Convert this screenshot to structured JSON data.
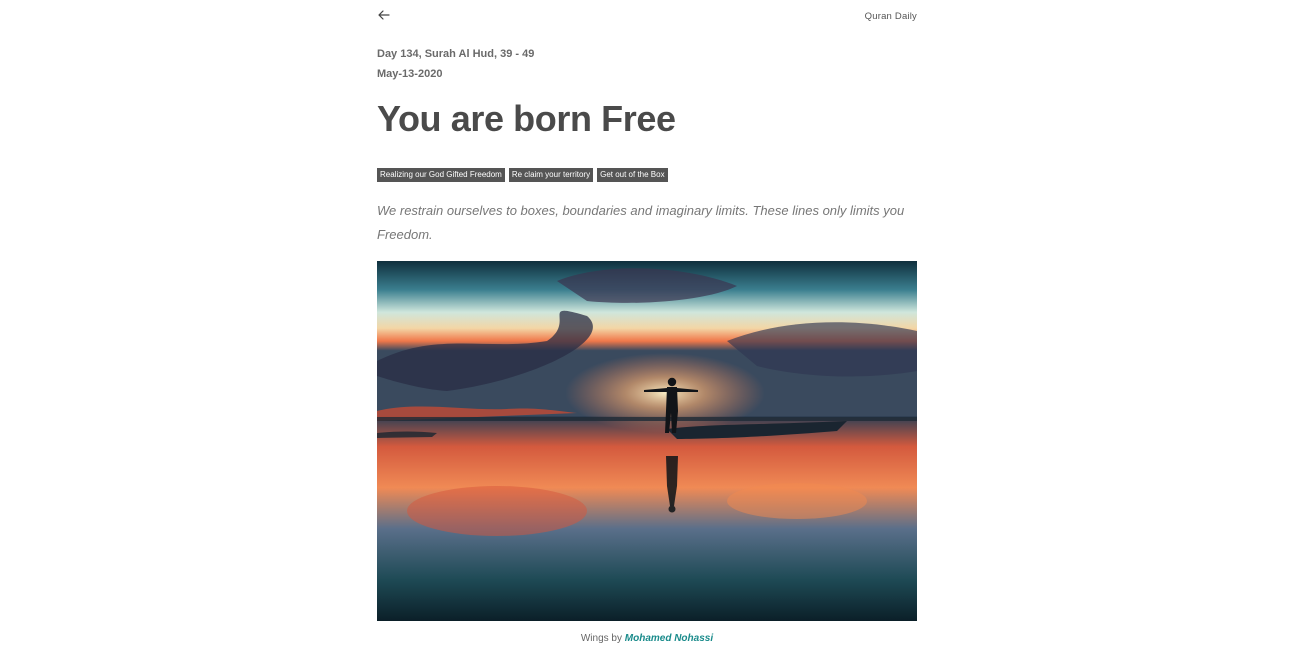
{
  "header": {
    "back_icon": "arrow-left-icon",
    "brand": "Quran Daily"
  },
  "meta": {
    "day_line": "Day 134, Surah Al Hud, 39 - 49",
    "date": "May-13-2020"
  },
  "article": {
    "title": "You are born Free",
    "tags": [
      "Realizing our God Gifted Freedom",
      "Re claim your territory",
      "Get out of the Box"
    ],
    "lead": "We restrain ourselves to boxes, boundaries and imaginary limits. These lines only limits you Freedom."
  },
  "image": {
    "caption_prefix": "Wings by",
    "caption_author": "Mohamed Nohassi"
  },
  "colors": {
    "text": "#4a4a4a",
    "tag_background": "#555555",
    "link": "#1a8b8b"
  }
}
